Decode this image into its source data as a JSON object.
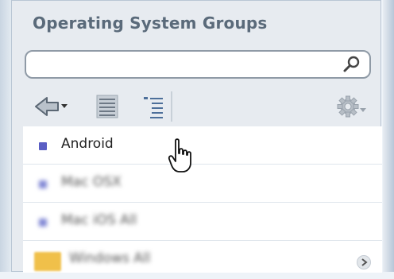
{
  "panel": {
    "title": "Operating System Groups"
  },
  "search": {
    "value": "",
    "placeholder": "",
    "icon": "search-icon"
  },
  "toolbar": {
    "back_icon": "back-arrow-dropdown-icon",
    "list_view_icon": "list-view-icon",
    "tree_view_icon": "tree-view-icon",
    "settings_icon": "gear-dropdown-icon"
  },
  "groups": [
    {
      "label": "Android",
      "icon": "group-icon"
    },
    {
      "label": "Mac OSX",
      "icon": "group-icon"
    },
    {
      "label": "Mac iOS All",
      "icon": "group-icon"
    },
    {
      "label": "Windows All",
      "icon": "folder-icon"
    }
  ],
  "colors": {
    "accent": "#5a5ec4",
    "title": "#5a6a7a",
    "folder": "#f0c04a"
  }
}
